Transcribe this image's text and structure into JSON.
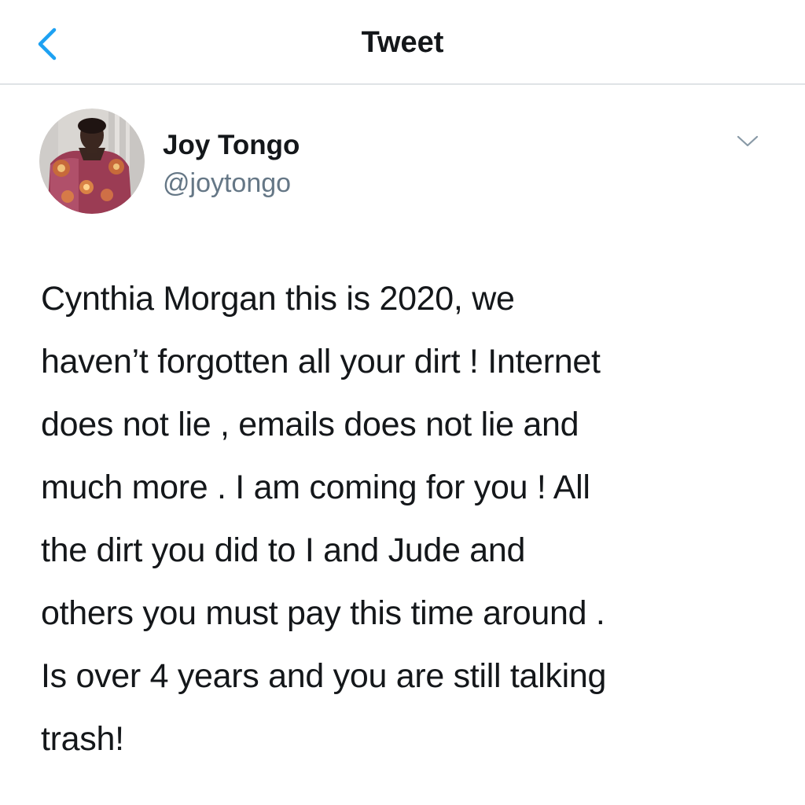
{
  "header": {
    "back_icon": "chevron-left-icon",
    "title": "Tweet"
  },
  "colors": {
    "accent": "#1da1f2",
    "text_primary": "#14171a",
    "text_secondary": "#657786",
    "divider": "#dfe3e6"
  },
  "tweet": {
    "author": {
      "name": "Joy Tongo",
      "handle": "@joytongo",
      "avatar_icon": "profile-photo"
    },
    "menu_icon": "chevron-down-icon",
    "text_lines": [
      "Cynthia Morgan this is 2020, we",
      "haven’t forgotten all your dirt ! Internet",
      "does not lie , emails does not lie and",
      "much more . I am coming for you ! All",
      "the dirt you did to I and Jude and",
      "others you must pay this time around .",
      "Is over 4 years and you are still talking",
      "trash!"
    ]
  }
}
